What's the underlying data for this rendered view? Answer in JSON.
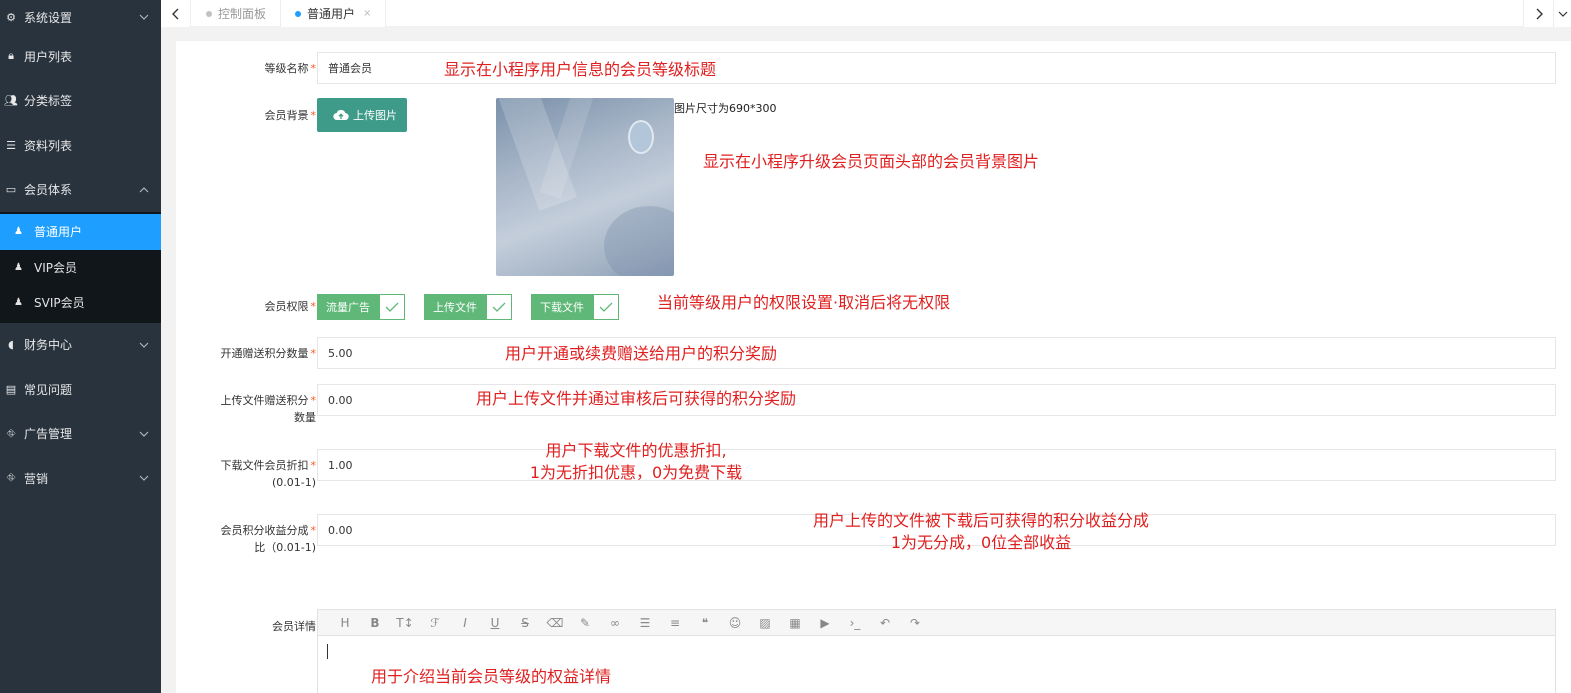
{
  "sidebar": {
    "items": [
      {
        "label": "系统设置",
        "icon": "gears-icon",
        "chevron": "down"
      },
      {
        "label": "用户列表",
        "icon": "user-lock-icon",
        "chevron": ""
      },
      {
        "label": "分类标签",
        "icon": "users-icon",
        "chevron": ""
      },
      {
        "label": "资料列表",
        "icon": "list-icon",
        "chevron": ""
      },
      {
        "label": "会员体系",
        "icon": "card-icon",
        "chevron": "up"
      }
    ],
    "submenu": [
      {
        "label": "普通用户",
        "icon": "user-icon",
        "active": true
      },
      {
        "label": "VIP会员",
        "icon": "user-icon",
        "active": false
      },
      {
        "label": "SVIP会员",
        "icon": "user-icon",
        "active": false
      }
    ],
    "items_after": [
      {
        "label": "财务中心",
        "icon": "shield-icon",
        "chevron": "down"
      },
      {
        "label": "常见问题",
        "icon": "faq-icon",
        "chevron": ""
      },
      {
        "label": "广告管理",
        "icon": "sitemap-icon",
        "chevron": "down"
      },
      {
        "label": "营销",
        "icon": "sitemap-icon",
        "chevron": "down"
      }
    ]
  },
  "tabs": [
    {
      "label": "控制面板",
      "active": false
    },
    {
      "label": "普通用户",
      "active": true,
      "close": "×"
    }
  ],
  "form": {
    "level_name": {
      "label": "等级名称",
      "value": "普通会员",
      "note": "显示在小程序用户信息的会员等级标题"
    },
    "background": {
      "label": "会员背景",
      "button": "上传图片",
      "size_note": "图片尺寸为690*300",
      "note": "显示在小程序升级会员页面头部的会员背景图片"
    },
    "permissions": {
      "label": "会员权限",
      "items": [
        "流量广告",
        "上传文件",
        "下载文件"
      ],
      "note": "当前等级用户的权限设置·取消后将无权限"
    },
    "open_points": {
      "label": "开通赠送积分数量",
      "value": "5.00",
      "note": "用户开通或续费赠送给用户的积分奖励"
    },
    "upload_points": {
      "label": "上传文件赠送积分",
      "label2": "数量",
      "value": "0.00",
      "note": "用户上传文件并通过审核后可获得的积分奖励"
    },
    "download_discount": {
      "label": "下载文件会员折扣",
      "label2": "(0.01-1)",
      "value": "1.00",
      "note1": "用户下载文件的优惠折扣,",
      "note2": "1为无折扣优惠，0为免费下载"
    },
    "revenue_share": {
      "label": "会员积分收益分成",
      "label2": "比（0.01-1)",
      "value": "0.00",
      "note1": "用户上传的文件被下载后可获得的积分收益分成",
      "note2": "1为无分成，0位全部收益"
    },
    "details": {
      "label": "会员详情",
      "note": "用于介绍当前会员等级的权益详情"
    }
  },
  "required_mark": "*",
  "colors": {
    "sidebar": "#28333e",
    "active": "#1e9fff",
    "upload": "#3e9b8a",
    "perm": "#5fb878",
    "annotation": "#e02020"
  }
}
